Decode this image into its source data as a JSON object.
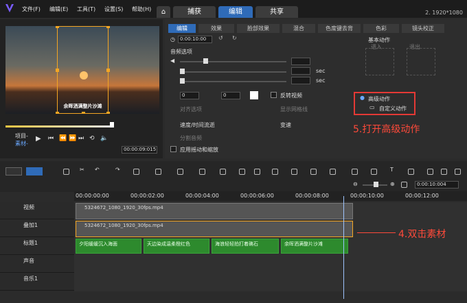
{
  "menu": {
    "items": [
      "文件(F)",
      "编辑(E)",
      "工具(T)",
      "设置(S)",
      "帮助(H)"
    ],
    "home_icon": "home-icon"
  },
  "tabs": {
    "capture": "捕获",
    "edit": "编辑",
    "share": "共享"
  },
  "resolution": "2. 1920*1080",
  "preview": {
    "caption": "余晖洒满整片沙滩",
    "project_label": "项目-",
    "clip_label": "素材-",
    "timecode": "00:00:09:015"
  },
  "options": {
    "tabs": [
      "编辑",
      "效果",
      "脸部效果",
      "混合",
      "色度键去背",
      "色彩",
      "镜头校正"
    ],
    "timecode": "0:00:10:00",
    "audio_section": "音频选项",
    "sec": "sec",
    "vals": {
      "rotate1": "0",
      "rotate2": "0"
    },
    "reverse": "反转视频",
    "split_audio": "分割音频",
    "speed": "速度/时间流逝",
    "varspeed": "变速",
    "show_grid": "显示网格线",
    "alignment": "对齐选项",
    "apply_motion": "应用摇动和缩放",
    "basic_motion": "基本动作",
    "enter": "进入",
    "exit": "退出",
    "advanced_motion": "高级动作",
    "custom_motion": "自定义动作",
    "annotation_open": "5.打开高级动作"
  },
  "timeline": {
    "timecode": "0:00:10:004",
    "ruler": [
      "00:00:00:00",
      "00:00:02:00",
      "00:00:04:00",
      "00:00:06:00",
      "00:00:08:00",
      "00:00:10:00",
      "00:00:12:00"
    ],
    "tracks": [
      {
        "name": "视频"
      },
      {
        "name": "叠加1"
      },
      {
        "name": "标题1"
      },
      {
        "name": "声音"
      },
      {
        "name": "音乐1"
      }
    ],
    "video_clip": "5324672_1080_1920_30fps.mp4",
    "overlay_clip": "5324672_1080_1920_30fps.mp4",
    "titles": [
      "夕阳缓缓沉入海面",
      "天边染成温柔橙红色",
      "海浪轻轻拍打着礁石",
      "余晖洒满整片沙滩"
    ],
    "annotation_double": "4.双击素材"
  },
  "colors": {
    "accent": "#2f6bb8",
    "annotation": "#ff4a3a",
    "title_clip": "#2d8a2d"
  }
}
